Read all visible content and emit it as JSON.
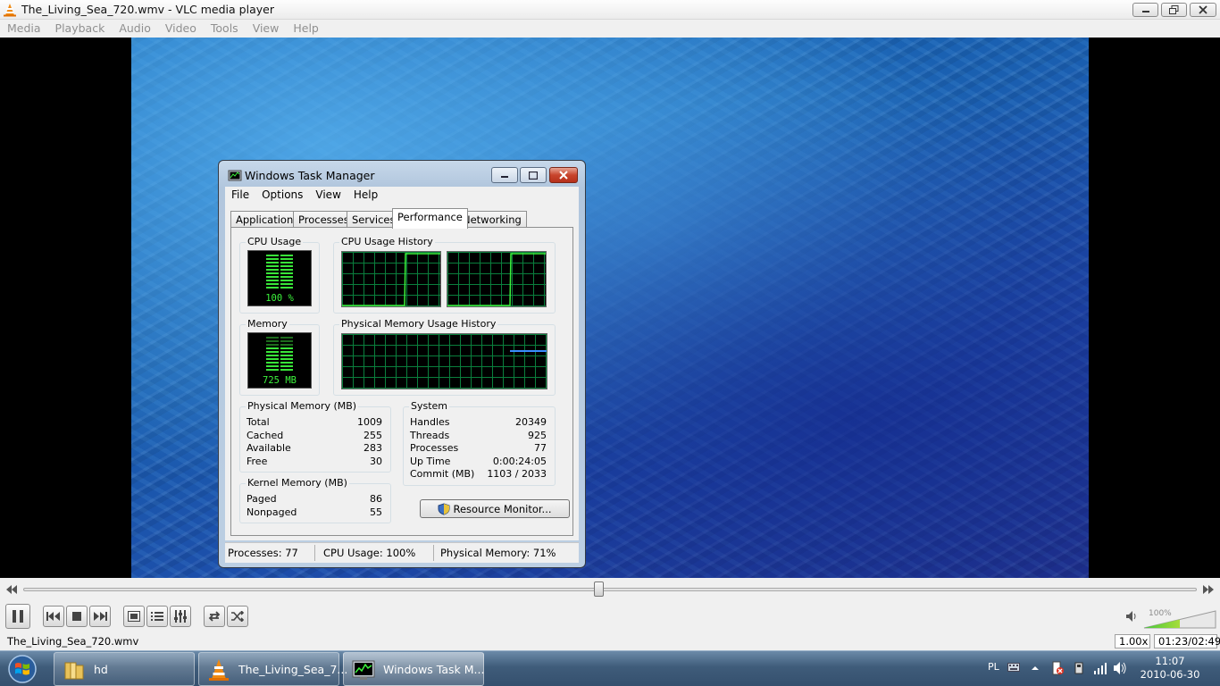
{
  "vlc": {
    "title": "The_Living_Sea_720.wmv - VLC media player",
    "menu": [
      "Media",
      "Playback",
      "Audio",
      "Video",
      "Tools",
      "View",
      "Help"
    ],
    "playback_progress": 0.49,
    "volume_label": "100%",
    "volume_level": 1.0,
    "status_filename": "The_Living_Sea_720.wmv",
    "speed": "1.00x",
    "time": "01:23/02:49",
    "icons": [
      "vlc-cone-icon",
      "pause-icon",
      "previous-icon",
      "stop-icon",
      "next-icon",
      "fullscreen-icon",
      "playlist-icon",
      "extended-settings-icon",
      "loop-icon",
      "shuffle-icon",
      "speaker-icon"
    ]
  },
  "taskmgr": {
    "title": "Windows Task Manager",
    "menu": [
      "File",
      "Options",
      "View",
      "Help"
    ],
    "tabs": [
      "Applications",
      "Processes",
      "Services",
      "Performance",
      "Networking"
    ],
    "active_tab": "Performance",
    "cpu_usage_label": "CPU Usage",
    "cpu_usage_value": "100 %",
    "cpu_history_label": "CPU Usage History",
    "memory_label": "Memory",
    "memory_value": "725 MB",
    "phys_history_label": "Physical Memory Usage History",
    "physical_memory": {
      "label": "Physical Memory (MB)",
      "rows": [
        {
          "key": "Total",
          "value": "1009"
        },
        {
          "key": "Cached",
          "value": "255"
        },
        {
          "key": "Available",
          "value": "283"
        },
        {
          "key": "Free",
          "value": "30"
        }
      ]
    },
    "kernel_memory": {
      "label": "Kernel Memory (MB)",
      "rows": [
        {
          "key": "Paged",
          "value": "86"
        },
        {
          "key": "Nonpaged",
          "value": "55"
        }
      ]
    },
    "system": {
      "label": "System",
      "rows": [
        {
          "key": "Handles",
          "value": "20349"
        },
        {
          "key": "Threads",
          "value": "925"
        },
        {
          "key": "Processes",
          "value": "77"
        },
        {
          "key": "Up Time",
          "value": "0:00:24:05"
        },
        {
          "key": "Commit (MB)",
          "value": "1103 / 2033"
        }
      ]
    },
    "resource_monitor_button": "Resource Monitor...",
    "status": {
      "processes": "Processes: 77",
      "cpu": "CPU Usage: 100%",
      "memory": "Physical Memory: 71%"
    }
  },
  "taskbar": {
    "buttons": [
      {
        "label": "hd",
        "icon": "folder-icon"
      },
      {
        "label": "The_Living_Sea_7...",
        "icon": "vlc-cone-icon"
      },
      {
        "label": "Windows Task M...",
        "icon": "task-manager-icon"
      }
    ],
    "language": "PL",
    "time": "11:07",
    "date": "2010-06-30"
  }
}
